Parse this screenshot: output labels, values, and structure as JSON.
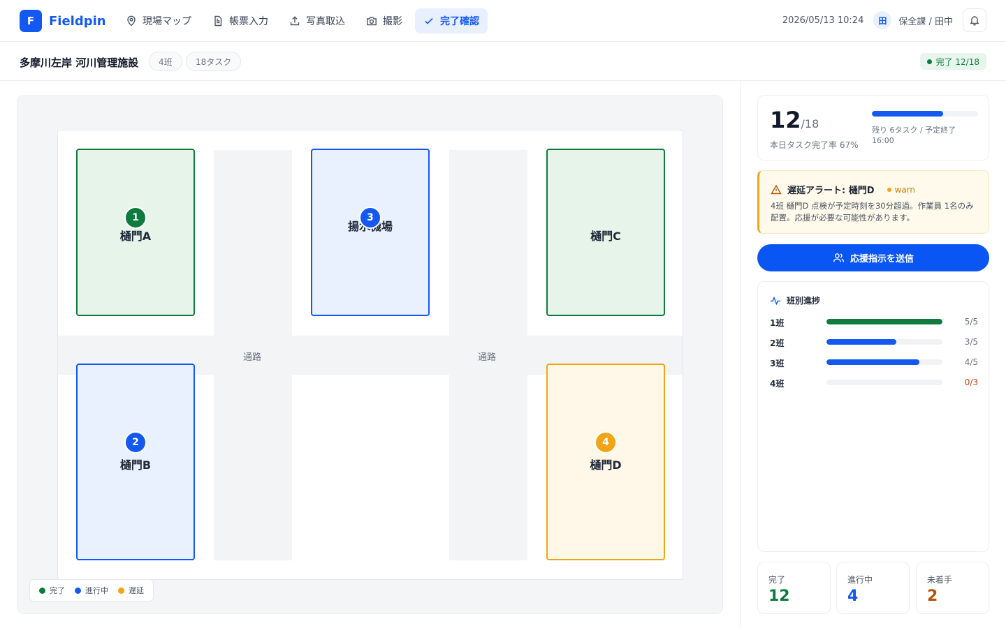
{
  "app": {
    "logo_letter": "F",
    "name": "Fieldpin"
  },
  "nav": [
    {
      "label": "現場マップ",
      "icon": "map-pin-icon",
      "active": false
    },
    {
      "label": "帳票入力",
      "icon": "document-icon",
      "active": false
    },
    {
      "label": "写真取込",
      "icon": "upload-icon",
      "active": false
    },
    {
      "label": "撮影",
      "icon": "camera-icon",
      "active": false
    },
    {
      "label": "完了確認",
      "icon": "check-icon",
      "active": true
    }
  ],
  "header": {
    "datetime": "2026/05/13 10:24",
    "user_badge": "田",
    "user": "保全課 / 田中",
    "bell_icon": "bell-icon"
  },
  "site": {
    "title": "多摩川左岸 河川管理施設",
    "chips": [
      "4班",
      "18タスク"
    ],
    "status": "完了 12/18"
  },
  "map": {
    "road_label": "通路",
    "zones": [
      {
        "id": "a",
        "label": "樋門A",
        "marker": "1",
        "status": "done"
      },
      {
        "id": "b",
        "label": "樋門B",
        "marker": "2",
        "status": "prog"
      },
      {
        "id": "pump",
        "label": "揚水機場",
        "marker": "3",
        "status": "prog"
      },
      {
        "id": "c",
        "label": "樋門C",
        "marker": "",
        "status": "done"
      },
      {
        "id": "d",
        "label": "樋門D",
        "marker": "4",
        "status": "late"
      }
    ],
    "legend": [
      {
        "label": "完了",
        "color": "#0f7a3d"
      },
      {
        "label": "進行中",
        "color": "#1358f0"
      },
      {
        "label": "遅延",
        "color": "#f2a417"
      }
    ]
  },
  "progress": {
    "done": "12",
    "total": "/18",
    "caption": "本日タスク完了率 67%",
    "ratio": 0.67,
    "remaining": "残り 6タスク / 予定終了 16:00",
    "color": "#1358f0"
  },
  "alert": {
    "icon": "warning-triangle-icon",
    "title": "遅延アラート: 樋門D",
    "level": "warn",
    "body": "4班 樋門D 点検が予定時刻を30分超過。作業員 1名のみ配置。応援が必要な可能性があります。"
  },
  "send_button": {
    "label": "応援指示を送信",
    "icon": "users-icon"
  },
  "teams": {
    "title": "班別進捗",
    "icon": "activity-icon",
    "rows": [
      {
        "name": "1班",
        "value": "5/5",
        "done": 5,
        "total": 5,
        "color": "#0f7a3d",
        "value_color": "#6b7280"
      },
      {
        "name": "2班",
        "value": "3/5",
        "done": 3,
        "total": 5,
        "color": "#1358f0",
        "value_color": "#6b7280"
      },
      {
        "name": "3班",
        "value": "4/5",
        "done": 4,
        "total": 5,
        "color": "#1358f0",
        "value_color": "#6b7280"
      },
      {
        "name": "4班",
        "value": "0/3",
        "done": 0,
        "total": 3,
        "color": "#1358f0",
        "value_color": "#c2410c"
      }
    ]
  },
  "stats": [
    {
      "label": "完了",
      "value": "12",
      "color": "#0f7a3d"
    },
    {
      "label": "進行中",
      "value": "4",
      "color": "#1358f0"
    },
    {
      "label": "未着手",
      "value": "2",
      "color": "#b45309"
    }
  ]
}
